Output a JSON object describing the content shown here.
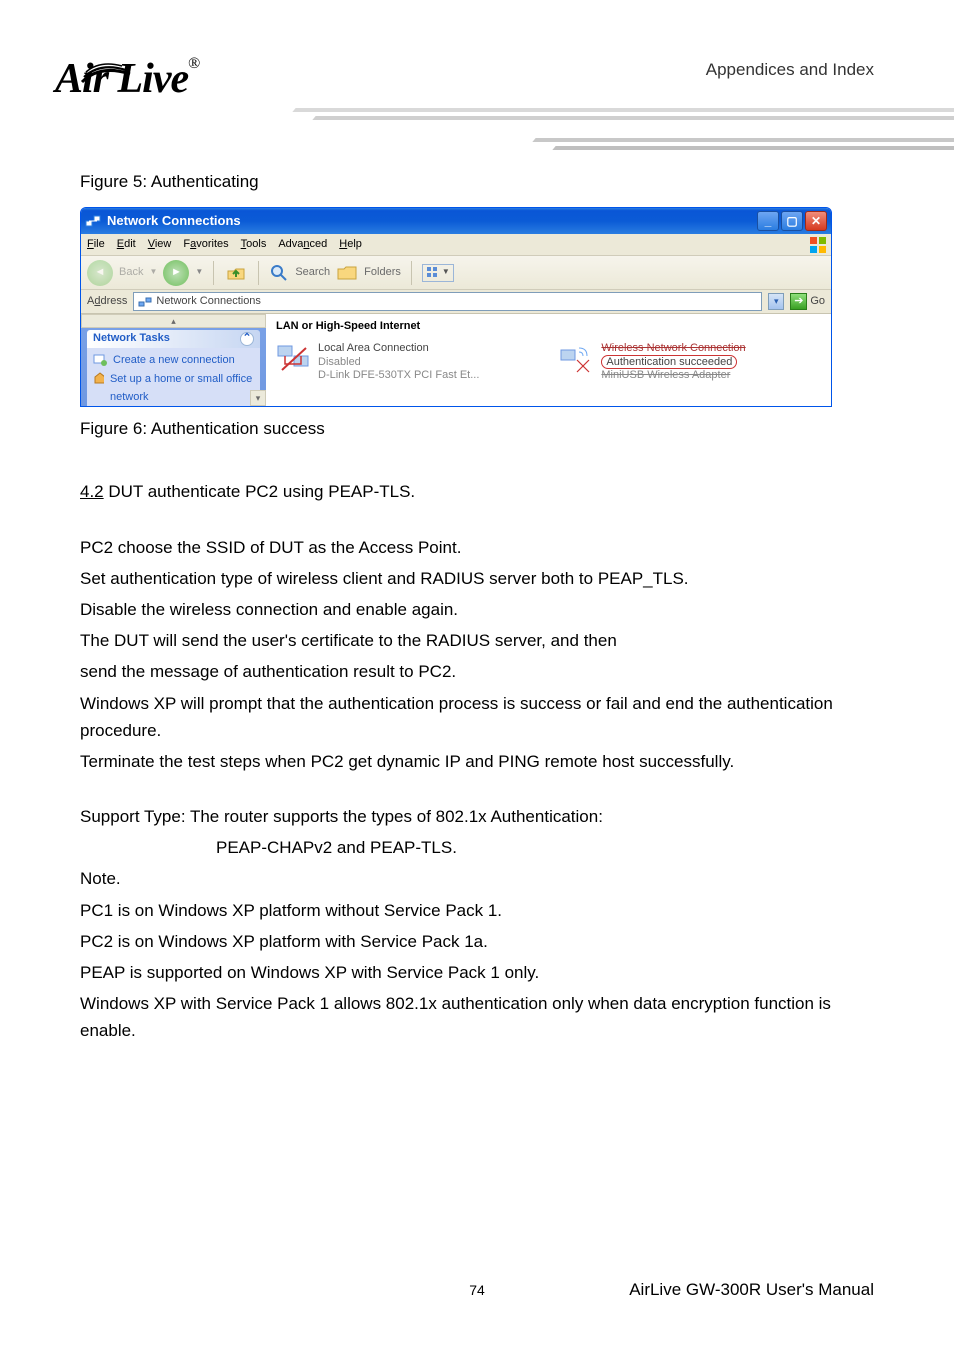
{
  "header": {
    "brand": "Air Live",
    "reg": "®",
    "section": "Appendices and Index"
  },
  "figure5_caption": "Figure 5: Authenticating",
  "figure6_caption": "Figure 6: Authentication success",
  "xp": {
    "title": "Network Connections",
    "menus": [
      "File",
      "Edit",
      "View",
      "Favorites",
      "Tools",
      "Advanced",
      "Help"
    ],
    "toolbar": {
      "back": "Back",
      "search": "Search",
      "folders": "Folders"
    },
    "addressLabel": "Address",
    "addressValue": "Network Connections",
    "go": "Go",
    "taskHead": "Network Tasks",
    "taskItem1": "Create a new connection",
    "taskItem2": "Set up a home or small office network",
    "category": "LAN or High-Speed Internet",
    "conn1": {
      "l1": "Local Area Connection",
      "l2": "Disabled",
      "l3": "D-Link DFE-530TX PCI Fast Et..."
    },
    "conn2": {
      "l1": "Wireless Network Connection",
      "l2": "Authentication succeeded",
      "l3": "MiniUSB Wireless Adapter"
    }
  },
  "body": {
    "s42_label": "4.2",
    "s42_rest": " DUT authenticate PC2 using PEAP-TLS.",
    "p1": "PC2 choose the SSID of DUT as the Access Point.",
    "p2": "Set authentication type of wireless client and RADIUS server both to PEAP_TLS.",
    "p3": "Disable the wireless connection and enable again.",
    "p4": "The DUT will send the user's certificate to the RADIUS server, and then",
    "p5": "send the message of authentication result to PC2.",
    "p6": "Windows XP will prompt that the authentication process is success or fail and end the authentication procedure.",
    "p7": "Terminate the test steps when PC2 get dynamic IP and PING remote host successfully.",
    "sup1": "Support Type: The router supports the types of   802.1x Authentication:",
    "sup2": "PEAP-CHAPv2 and PEAP-TLS.",
    "note": "Note.",
    "n1": "PC1 is on Windows XP platform without Service Pack 1.",
    "n2": "PC2 is on Windows XP platform with Service Pack 1a.",
    "n3": "PEAP is supported on Windows XP with Service Pack 1 only.",
    "n4": "Windows XP with Service Pack 1 allows 802.1x authentication only when data encryption function is enable."
  },
  "footer": {
    "page": "74",
    "doc": "AirLive GW-300R User's Manual"
  }
}
